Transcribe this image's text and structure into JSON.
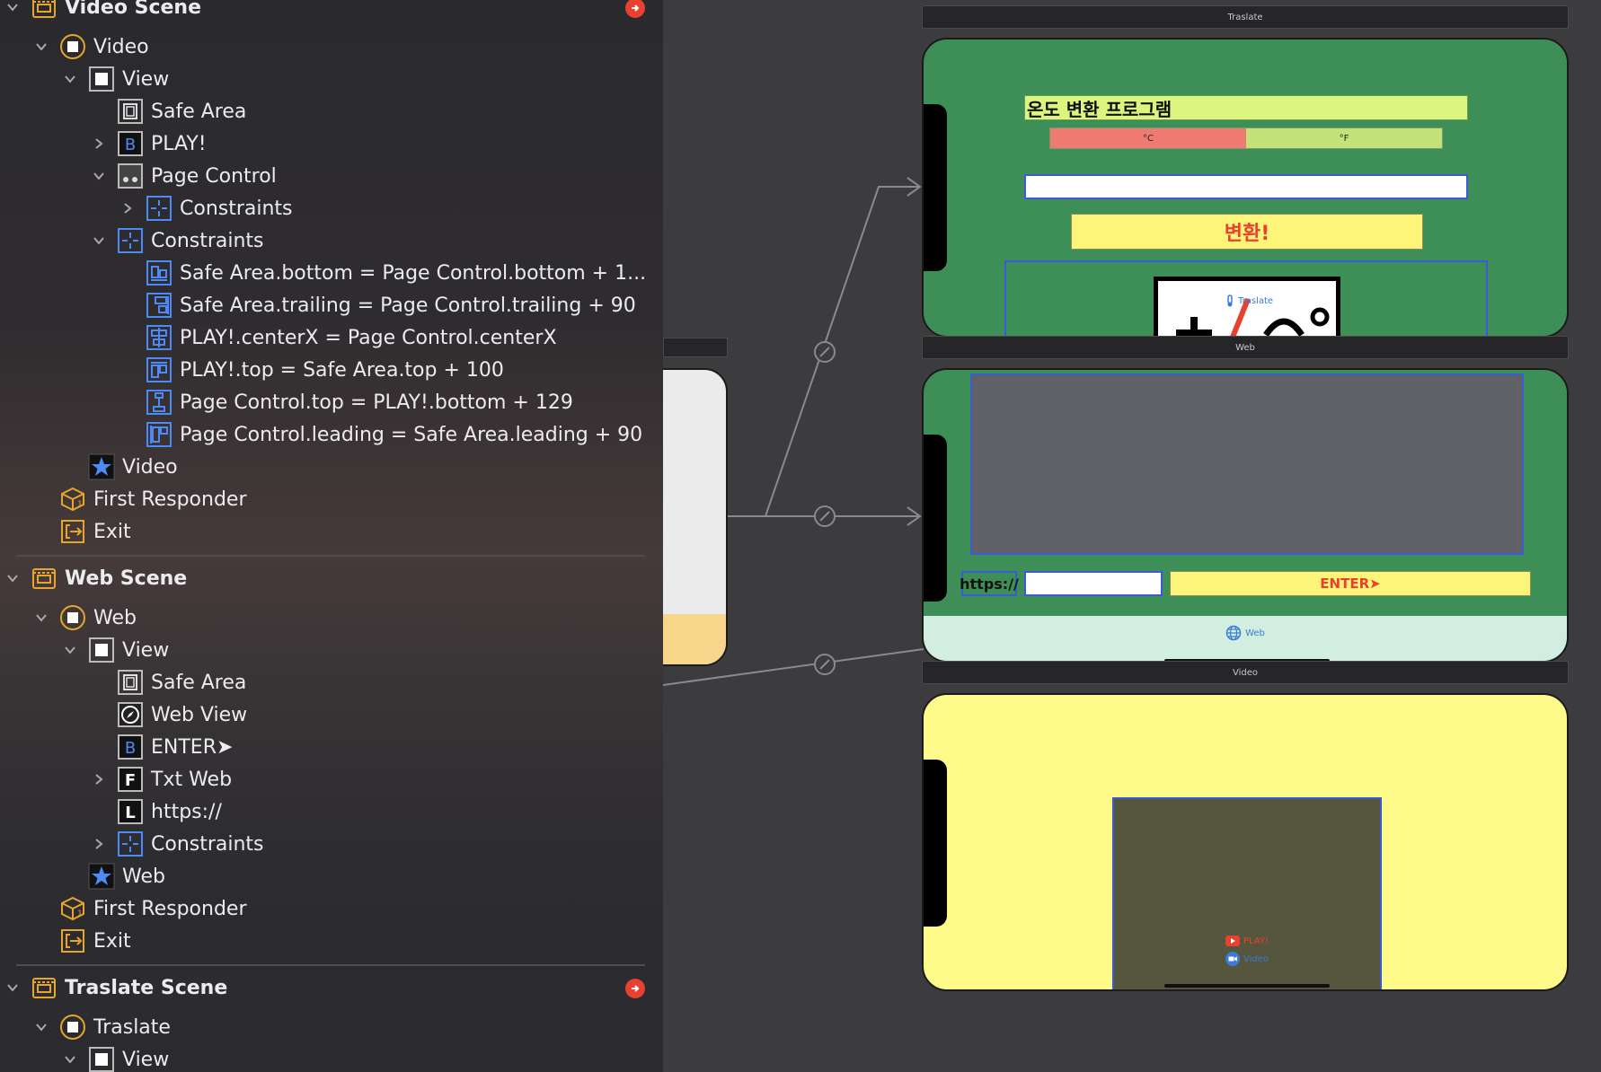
{
  "outline": {
    "video_scene": {
      "title": "Video Scene",
      "controller": "Video",
      "view": "View",
      "safe_area": "Safe Area",
      "play_button": "PLAY!",
      "page_control": "Page Control",
      "page_control_constraints": "Constraints",
      "constraints_group": "Constraints",
      "constraints": [
        "Safe Area.bottom = Page Control.bottom + 1...",
        "Safe Area.trailing = Page Control.trailing + 90",
        "PLAY!.centerX = Page Control.centerX",
        "PLAY!.top = Safe Area.top + 100",
        "Page Control.top = PLAY!.bottom + 129",
        "Page Control.leading = Safe Area.leading + 90"
      ],
      "tab_item": "Video",
      "first_responder": "First Responder",
      "exit": "Exit"
    },
    "web_scene": {
      "title": "Web Scene",
      "controller": "Web",
      "view": "View",
      "safe_area": "Safe Area",
      "web_view": "Web View",
      "enter_button": "ENTER➤",
      "txt_web": "Txt Web",
      "https_label": "https://",
      "constraints": "Constraints",
      "tab_item": "Web",
      "first_responder": "First Responder",
      "exit": "Exit"
    },
    "traslate_scene": {
      "title": "Traslate Scene",
      "controller": "Traslate",
      "view": "View"
    },
    "icon_letters": {
      "button": "B",
      "textfield": "F",
      "label": "L"
    }
  },
  "canvas": {
    "traslate": {
      "title": "Traslate",
      "heading": "온도 변환 프로그램",
      "seg_celsius": "°C",
      "seg_fahrenheit": "°F",
      "convert_button": "변환!",
      "tab_hint": "Traslate",
      "colors": {
        "background": "#3e8f57",
        "heading_bg": "#dbf57e",
        "seg_left": "#ee7a72",
        "seg_right": "#c3e277",
        "button_bg": "#fdf47a",
        "button_text": "#e8412f"
      }
    },
    "web": {
      "title": "Web",
      "prefix_label": "https://",
      "enter_button": "ENTER➤",
      "tab_label": "Web",
      "colors": {
        "background": "#3e8f57",
        "webview": "#5f6166",
        "tabbar": "#d2eee0",
        "button_bg": "#fdf47a",
        "button_text": "#e8412f"
      }
    },
    "video": {
      "title": "Video",
      "play_tab": "PLAY!",
      "video_tab": "Video",
      "colors": {
        "background": "#fefb8a",
        "inner": "#56553e"
      }
    }
  }
}
